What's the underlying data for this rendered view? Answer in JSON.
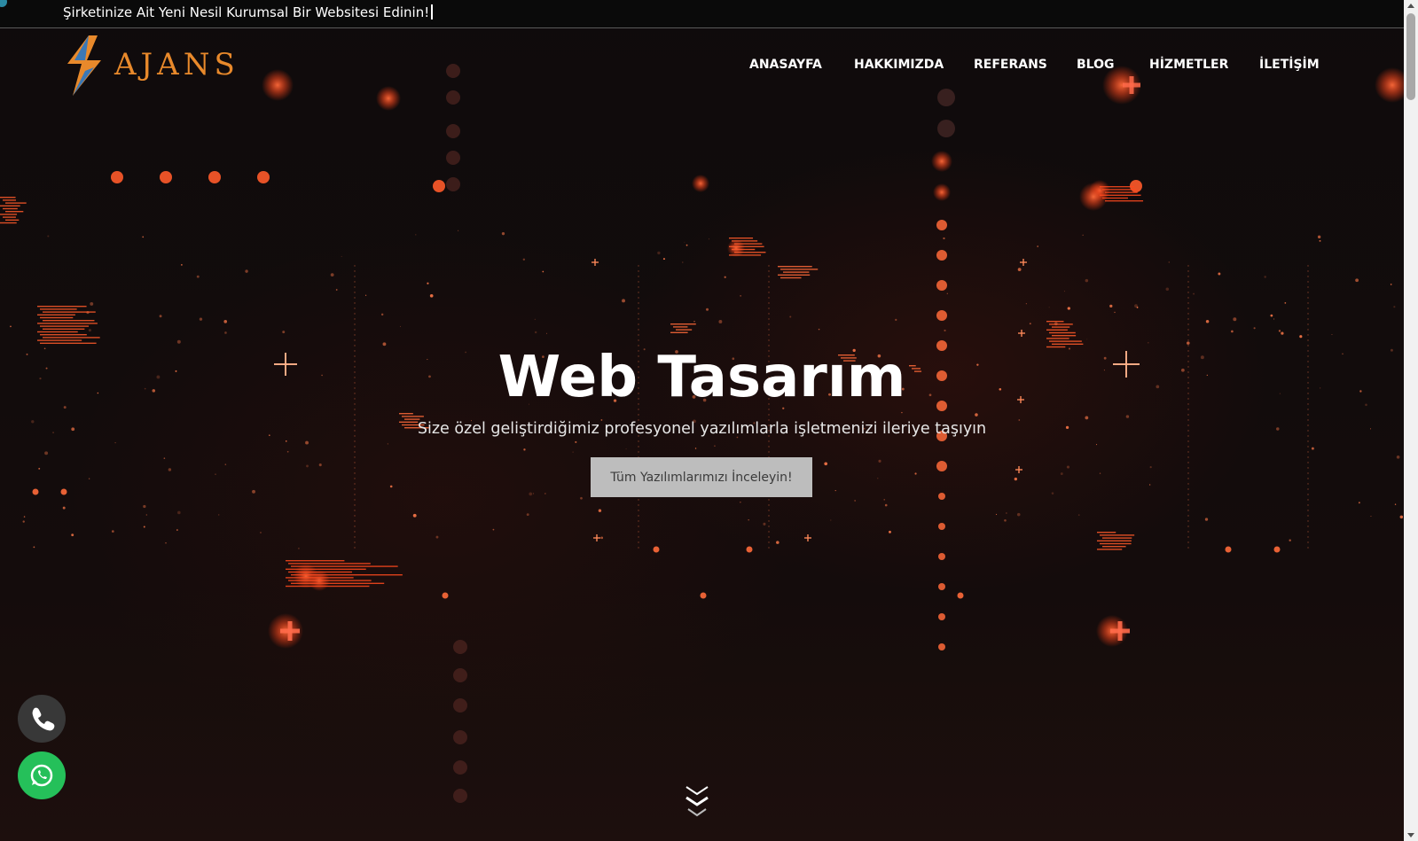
{
  "topbar": {
    "announcement": "Şirketinize Ait Yeni Nesil Kurumsal Bir Websitesi Edinin!"
  },
  "logo": {
    "text": "AJANS",
    "icon": "lightning-logo-icon"
  },
  "nav": {
    "items": [
      {
        "label": "ANASAYFA"
      },
      {
        "label": "HAKKIMIZDA"
      },
      {
        "label": "REFERANS"
      },
      {
        "label": "BLOG"
      },
      {
        "label": "HİZMETLER"
      },
      {
        "label": "İLETİŞİM"
      }
    ]
  },
  "hero": {
    "title": "Web Tasarım",
    "subtitle": "Size özel geliştirdiğimiz profesyonel yazılımlarla işletmenizi ileriye taşıyın",
    "cta_label": "Tüm Yazılımlarımızı İnceleyin!",
    "scroll_icon": "chevrons-down-icon"
  },
  "floating_buttons": {
    "phone_icon": "phone-icon",
    "whatsapp_icon": "whatsapp-icon"
  },
  "colors": {
    "accent": "#e8892b",
    "glow": "#ff5a2a",
    "background": "#100b0c",
    "whatsapp": "#25c05a",
    "button_bg": "#bdbdbd"
  }
}
